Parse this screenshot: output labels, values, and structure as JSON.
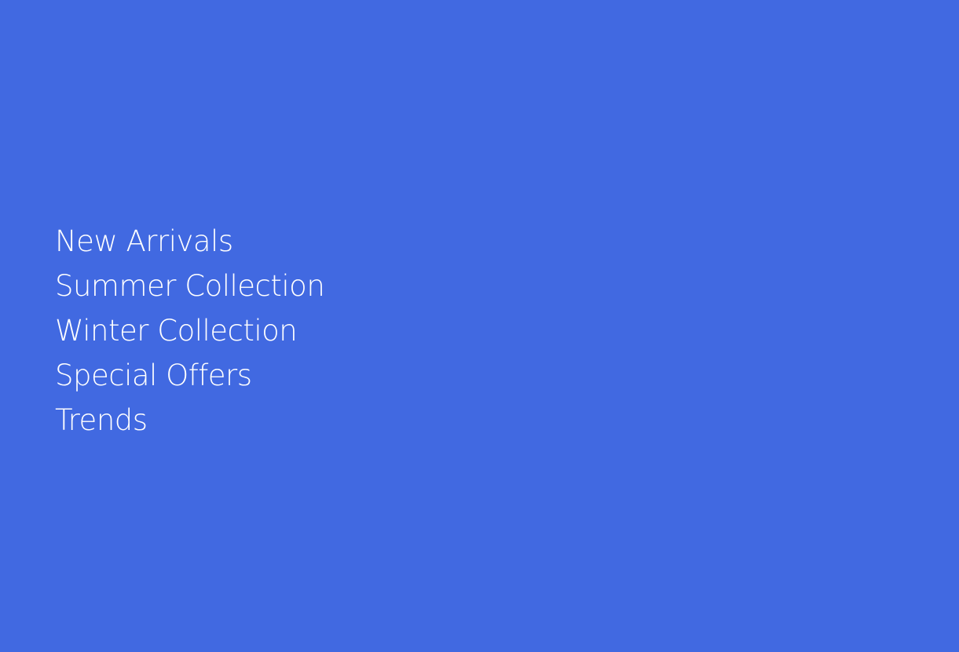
{
  "theme": {
    "background": "#4169e1",
    "text_color": "#ffffff"
  },
  "menu": {
    "items": [
      {
        "label": "New Arrivals"
      },
      {
        "label": "Summer Collection"
      },
      {
        "label": "Winter Collection"
      },
      {
        "label": "Special Offers"
      },
      {
        "label": "Trends"
      }
    ]
  }
}
